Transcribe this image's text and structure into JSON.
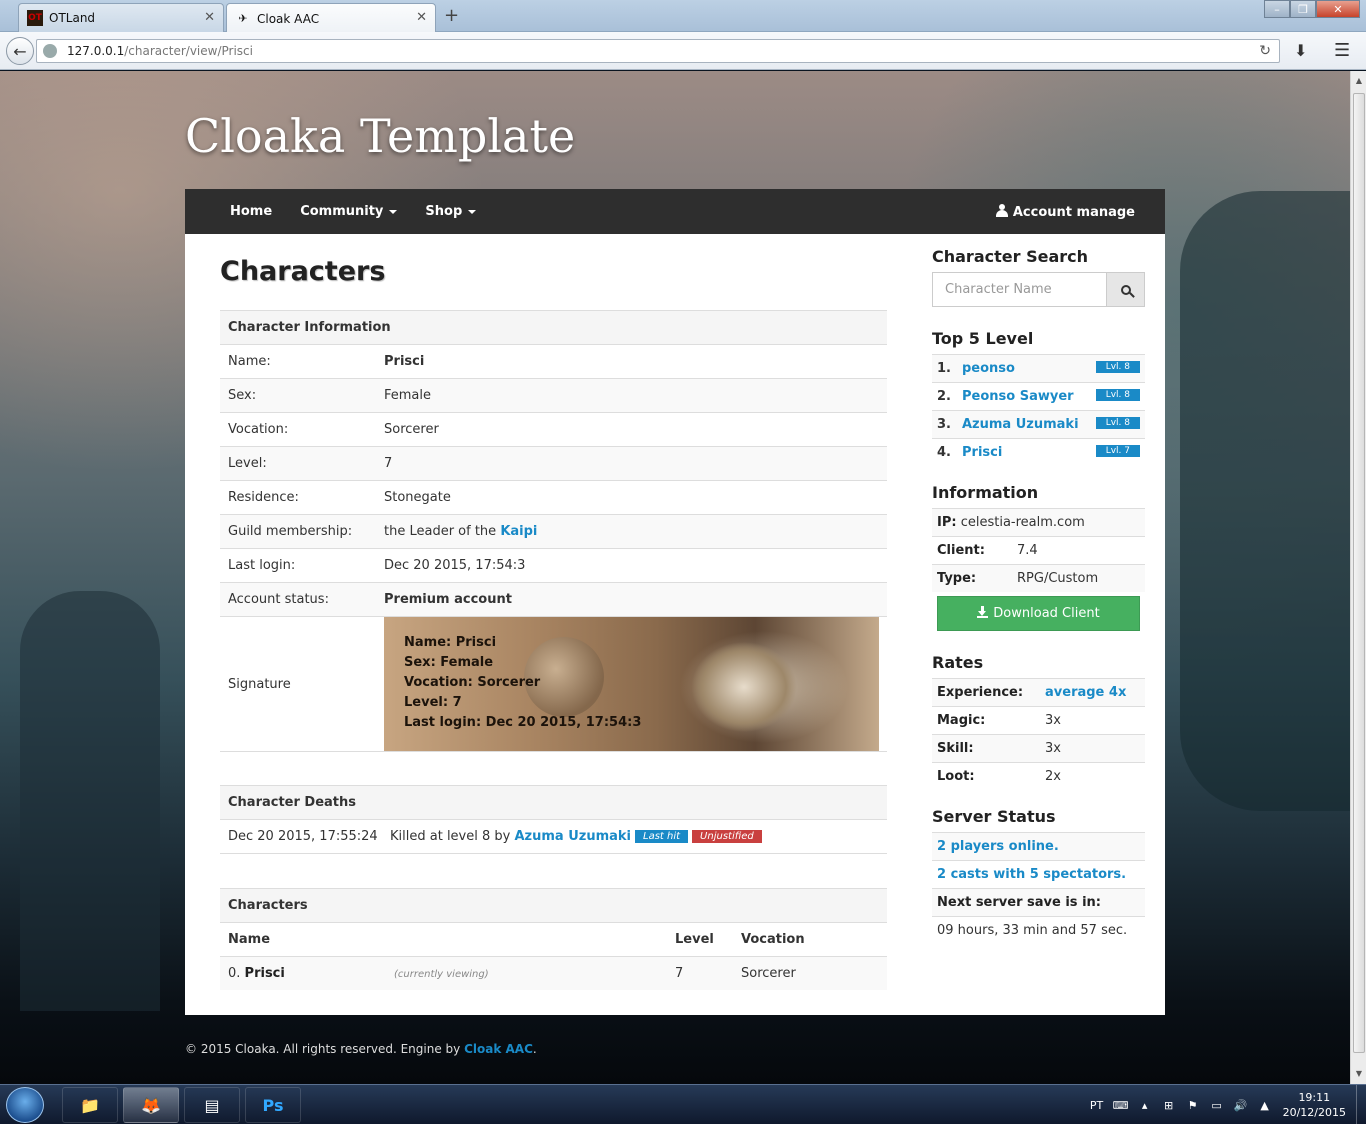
{
  "browser": {
    "tabs": [
      {
        "label": "OTLand",
        "active": false
      },
      {
        "label": "Cloak AAC",
        "active": true
      }
    ],
    "url_host": "127.0.0.1",
    "url_path": "/character/view/Prisci"
  },
  "site": {
    "title": "Cloaka Template",
    "nav": {
      "home": "Home",
      "community": "Community",
      "shop": "Shop",
      "account": "Account manage"
    }
  },
  "main": {
    "page_title": "Characters",
    "info_header": "Character Information",
    "info": [
      {
        "key": "Name:",
        "value": "Prisci"
      },
      {
        "key": "Sex:",
        "value": "Female"
      },
      {
        "key": "Vocation:",
        "value": "Sorcerer"
      },
      {
        "key": "Level:",
        "value": "7"
      },
      {
        "key": "Residence:",
        "value": "Stonegate"
      },
      {
        "key": "Guild membership:",
        "prefix": "the Leader of the ",
        "link": "Kaipi"
      },
      {
        "key": "Last login:",
        "value": "Dec 20 2015, 17:54:3"
      },
      {
        "key": "Account status:",
        "value": "Premium account"
      },
      {
        "key": "Signature"
      }
    ],
    "signature_lines": [
      "Name: Prisci",
      "Sex: Female",
      "Vocation: Sorcerer",
      "Level: 7",
      "Last login: Dec 20 2015, 17:54:3"
    ],
    "deaths_header": "Character Deaths",
    "death": {
      "date": "Dec 20 2015, 17:55:24",
      "text": "Killed at level 8 by ",
      "killer": "Azuma Uzumaki",
      "badge1": "Last hit",
      "badge2": "Unjustified"
    },
    "chars_header": "Characters",
    "chars_cols": {
      "name": "Name",
      "level": "Level",
      "vocation": "Vocation"
    },
    "chars_row": {
      "index": "0.",
      "name": "Prisci",
      "note": "(currently viewing)",
      "level": "7",
      "vocation": "Sorcerer"
    }
  },
  "sidebar": {
    "search_title": "Character Search",
    "search_placeholder": "Character Name",
    "top_title": "Top 5 Level",
    "top": [
      {
        "rank": "1.",
        "name": "peonso",
        "lvl": "Lvl. 8"
      },
      {
        "rank": "2.",
        "name": "Peonso Sawyer",
        "lvl": "Lvl. 8"
      },
      {
        "rank": "3.",
        "name": "Azuma Uzumaki",
        "lvl": "Lvl. 8"
      },
      {
        "rank": "4.",
        "name": "Prisci",
        "lvl": "Lvl. 7"
      }
    ],
    "info_title": "Information",
    "ip_label": "IP:",
    "ip": "celestia-realm.com",
    "client_label": "Client:",
    "client": "7.4",
    "type_label": "Type:",
    "type": "RPG/Custom",
    "download": "Download Client",
    "rates_title": "Rates",
    "rates": [
      {
        "k": "Experience:",
        "v": "average 4x"
      },
      {
        "k": "Magic:",
        "v": "3x"
      },
      {
        "k": "Skill:",
        "v": "3x"
      },
      {
        "k": "Loot:",
        "v": "2x"
      }
    ],
    "status_title": "Server Status",
    "players": "2 players online.",
    "casts": "2 casts with 5 spectators.",
    "save_label": "Next server save is in:",
    "save_time": "09 hours, 33 min and 57 sec."
  },
  "footer": {
    "text": "© 2015 Cloaka. All rights reserved. Engine by ",
    "link": "Cloak AAC",
    "end": "."
  },
  "taskbar": {
    "lang": "PT",
    "time": "19:11",
    "date": "20/12/2015",
    "ps": "Ps"
  }
}
